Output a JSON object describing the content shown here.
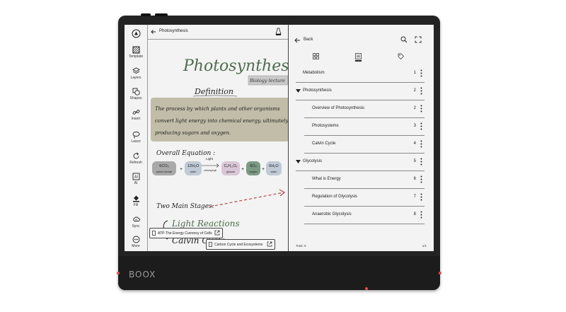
{
  "brand": "BOOX",
  "colors": {
    "accent_red": "#e05045",
    "pen_green": "#4f6b4e",
    "highlight": "#b7b39a"
  },
  "toolbar": {
    "items": [
      {
        "label": "Template",
        "icon": "template-icon"
      },
      {
        "label": "Layers",
        "icon": "layers-icon"
      },
      {
        "label": "Shapes",
        "icon": "shapes-icon"
      },
      {
        "label": "Insert",
        "icon": "insert-link-icon"
      },
      {
        "label": "Lasso",
        "icon": "lasso-icon"
      },
      {
        "label": "Refresh",
        "icon": "refresh-icon"
      },
      {
        "label": "AI",
        "icon": "ai-icon"
      },
      {
        "label": "Fill",
        "icon": "fill-icon"
      },
      {
        "label": "Sync",
        "icon": "sync-icon"
      },
      {
        "label": "More",
        "icon": "more-icon"
      }
    ]
  },
  "note": {
    "title": "Photosynthesis",
    "handwriting": {
      "heading": "Photosynthesis",
      "tag": "Biology lecture",
      "definition": "Definition",
      "def_lines": [
        "The process by which plants and other organisms",
        "convert light energy into chemical energy, ultimately",
        "producing sugars and oxygen."
      ],
      "equation_label": "Overall Equation :",
      "eq_items": [
        "6CO₂",
        "12H₂O",
        "C₆H₁₂O₆",
        "6O₂",
        "6H₂O"
      ],
      "eq_sub": [
        "carbon dioxide",
        "water",
        "glucose",
        "oxygen",
        "water"
      ],
      "light_top": "Light",
      "light_bottom": "chlorophyll",
      "stages_label": "Two Main Stages:",
      "stage1": "Light Reactions",
      "stage2": "Calvin Cycle"
    },
    "links": [
      {
        "label": "ATP-The Energy Currency of Cells"
      },
      {
        "label": "Carbon Cycle and Ecosystems"
      }
    ]
  },
  "toc": {
    "back_label": "Back",
    "tabs": [
      "grid-view",
      "list-view",
      "tag-view"
    ],
    "items": [
      {
        "label": "Metabolism",
        "page": "1",
        "level": 0,
        "expandable": false
      },
      {
        "label": "Photosynthesis",
        "page": "2",
        "level": 0,
        "expandable": true
      },
      {
        "label": "Overview of Photosynthesis",
        "page": "2",
        "level": 1,
        "expandable": false
      },
      {
        "label": "Photosystems",
        "page": "3",
        "level": 1,
        "expandable": false
      },
      {
        "label": "Calvin Cycle",
        "page": "4",
        "level": 1,
        "expandable": false
      },
      {
        "label": "Glycolysis",
        "page": "5",
        "level": 0,
        "expandable": true
      },
      {
        "label": "What is Energy",
        "page": "6",
        "level": 1,
        "expandable": false
      },
      {
        "label": "Regulation of Glycolysis",
        "page": "7",
        "level": 1,
        "expandable": false
      },
      {
        "label": "Anaerobic Glycolysis",
        "page": "8",
        "level": 1,
        "expandable": false
      }
    ],
    "total_label": "Total:",
    "total_value": "9",
    "page_indicator": "1/1"
  }
}
